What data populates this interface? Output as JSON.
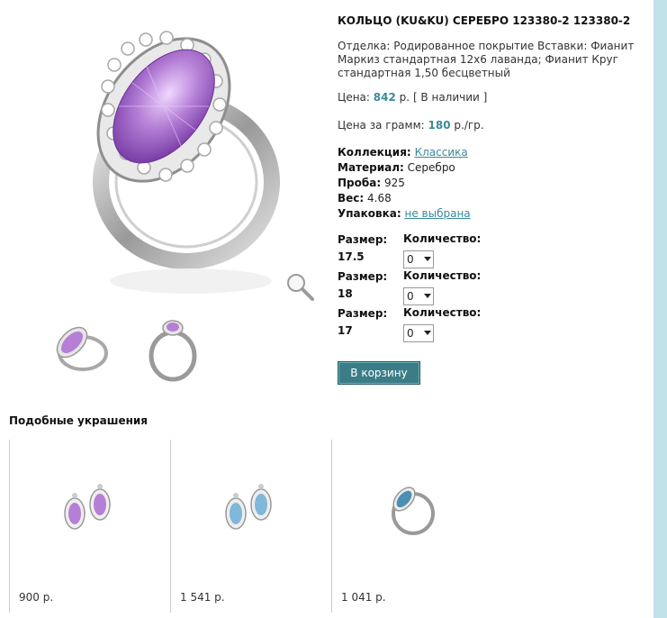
{
  "product": {
    "title": "КОЛЬЦО (KU&KU) СЕРЕБРО 123380-2 123380-2",
    "description": "Отделка: Родированное покрытие Вставки: Фианит Маркиз стандартная 12х6 лаванда; Фианит Круг стандартная 1,50 бесцветный",
    "price_label": "Цена:",
    "price_value": "842",
    "price_unit": "р.",
    "availability": "[ В наличии ]",
    "gram_label": "Цена за грамм:",
    "gram_value": "180",
    "gram_unit": "р./гр."
  },
  "props": {
    "collection_label": "Коллекция:",
    "collection_value": "Классика",
    "material_label": "Материал:",
    "material_value": "Серебро",
    "probe_label": "Проба:",
    "probe_value": "925",
    "weight_label": "Вес:",
    "weight_value": "4.68",
    "package_label": "Упаковка:",
    "package_value": "не выбрана"
  },
  "sizes": [
    {
      "size_label": "Размер:",
      "size_value": "17.5",
      "qty_label": "Количество:",
      "qty_value": "0"
    },
    {
      "size_label": "Размер:",
      "size_value": "18",
      "qty_label": "Количество:",
      "qty_value": "0"
    },
    {
      "size_label": "Размер:",
      "size_value": "17",
      "qty_label": "Количество:",
      "qty_value": "0"
    }
  ],
  "cart_button": "В корзину",
  "similar": {
    "title": "Подобные украшения",
    "items": [
      {
        "price": "900 р.",
        "icon": "lavender-earrings-icon"
      },
      {
        "price": "1 541 р.",
        "icon": "blue-earrings-icon"
      },
      {
        "price": "1 041 р.",
        "icon": "blue-ring-icon"
      }
    ]
  },
  "colors": {
    "accent": "#3a8a9a",
    "button": "#3a7d87",
    "side_strip": "#bfe3e8",
    "gem_lavender": "#b57fd6",
    "gem_blue": "#7fb8d8"
  }
}
